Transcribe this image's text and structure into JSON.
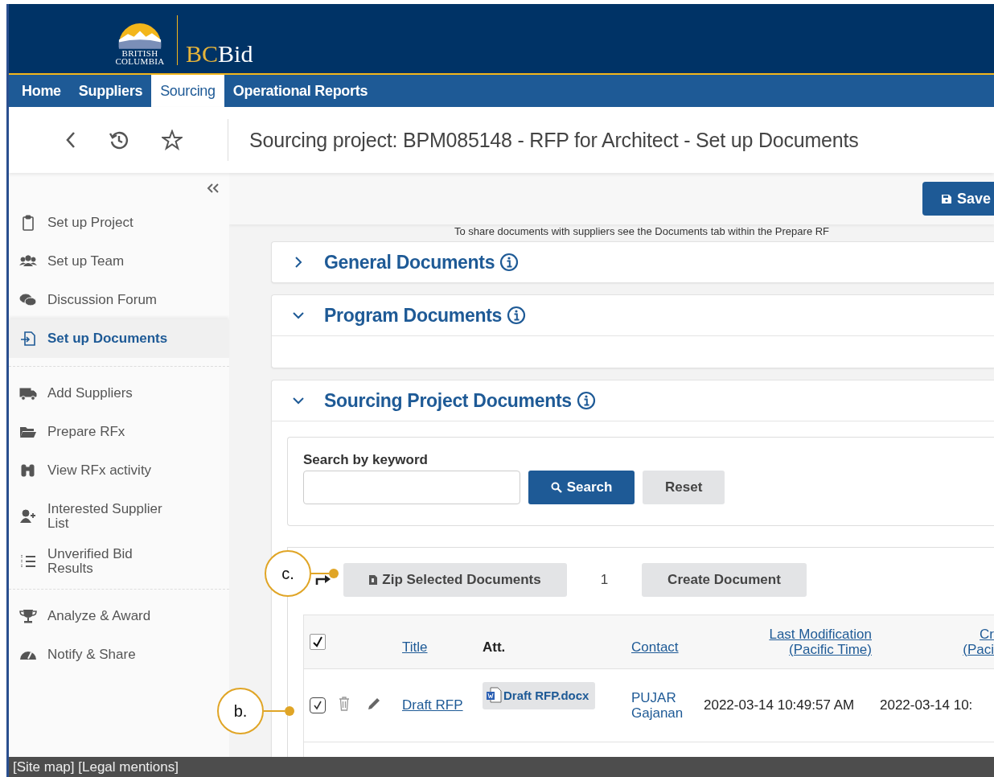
{
  "header": {
    "logo": {
      "line1": "BRITISH",
      "line2": "COLUMBIA",
      "brand_prefix": "BC",
      "brand_suffix": "Bid"
    }
  },
  "nav_tabs": [
    {
      "label": "Home",
      "selected": false
    },
    {
      "label": "Suppliers",
      "selected": false
    },
    {
      "label": "Sourcing",
      "selected": true
    },
    {
      "label": "Operational Reports",
      "selected": false
    }
  ],
  "page_title": "Sourcing project: BPM085148 - RFP for Architect - Set up Documents",
  "sidebar": {
    "groups": [
      {
        "items": [
          {
            "label": "Set up Project",
            "selected": false
          },
          {
            "label": "Set up Team",
            "selected": false
          },
          {
            "label": "Discussion Forum",
            "selected": false
          },
          {
            "label": "Set up Documents",
            "selected": true
          }
        ]
      },
      {
        "items": [
          {
            "label": "Add Suppliers",
            "selected": false
          },
          {
            "label": "Prepare RFx",
            "selected": false
          },
          {
            "label": "View RFx activity",
            "selected": false
          },
          {
            "label": "Interested Supplier List",
            "selected": false
          },
          {
            "label": "Unverified Bid Results",
            "selected": false
          }
        ]
      },
      {
        "items": [
          {
            "label": "Analyze & Award",
            "selected": false
          },
          {
            "label": "Notify & Share",
            "selected": false
          }
        ]
      }
    ]
  },
  "save_button": "Save",
  "notice": "To share documents with suppliers see the Documents tab within the Prepare RF",
  "sections": [
    {
      "title": "General Documents",
      "expanded": false
    },
    {
      "title": "Program Documents",
      "expanded": true
    },
    {
      "title": "Sourcing Project Documents",
      "expanded": true,
      "search": {
        "label": "Search by keyword",
        "search_button": "Search",
        "reset_button": "Reset"
      },
      "actions": {
        "zip_button": "Zip Selected Documents",
        "count": "1",
        "create_button": "Create Document"
      },
      "table": {
        "select_all": {
          "checked": true
        },
        "columns": [
          {
            "lines": [
              "Title"
            ],
            "link": true
          },
          {
            "lines": [
              "Att."
            ],
            "link": false
          },
          {
            "lines": [
              "Contact"
            ],
            "link": true
          },
          {
            "lines": [
              "Last Modification",
              "(Pacific Time)"
            ],
            "link": true
          },
          {
            "lines": [
              "Cr",
              "(Paci"
            ],
            "link": true
          }
        ],
        "rows": [
          {
            "checked": true,
            "title": "Draft RFP",
            "attachment": "Draft RFP.docx",
            "contact": "PUJAR Gajanan",
            "last_modification": "2022-03-14 10:49:57 AM",
            "created": "2022-03-14 10:"
          }
        ]
      }
    }
  ],
  "annotations": [
    {
      "label": "c."
    },
    {
      "label": "b."
    }
  ],
  "footer": "[Site map] [Legal mentions]"
}
